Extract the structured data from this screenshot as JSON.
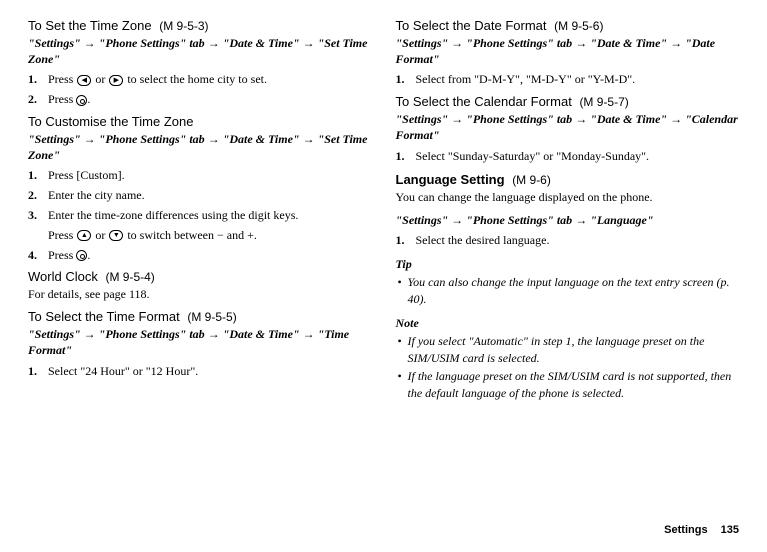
{
  "left": {
    "setTimeZone": {
      "title": "To Set the Time Zone",
      "code": "(M 9-5-3)",
      "path": [
        "\"Settings\"",
        "\"Phone Settings\" tab",
        "\"Date & Time\"",
        "\"Set Time Zone\""
      ],
      "steps": [
        "Press ◀ or ▶ to select the home city to set.",
        "Press ⦿."
      ]
    },
    "customiseTimeZone": {
      "title": "To Customise the Time Zone",
      "path": [
        "\"Settings\"",
        "\"Phone Settings\" tab",
        "\"Date & Time\"",
        "\"Set Time Zone\""
      ],
      "steps": [
        "Press [Custom].",
        "Enter the city name.",
        "Enter the time-zone differences using the digit keys.",
        "Press ⦿."
      ],
      "sub3": "Press ▲ or ▼ to switch between − and +."
    },
    "worldClock": {
      "title": "World Clock",
      "code": "(M 9-5-4)",
      "text": "For details, see page 118."
    },
    "timeFormat": {
      "title": "To Select the Time Format",
      "code": "(M 9-5-5)",
      "path": [
        "\"Settings\"",
        "\"Phone Settings\" tab",
        "\"Date & Time\"",
        "\"Time Format\""
      ],
      "steps": [
        "Select \"24 Hour\" or \"12 Hour\"."
      ]
    }
  },
  "right": {
    "dateFormat": {
      "title": "To Select the Date Format",
      "code": "(M 9-5-6)",
      "path": [
        "\"Settings\"",
        "\"Phone Settings\" tab",
        "\"Date & Time\"",
        "\"Date Format\""
      ],
      "steps": [
        "Select from \"D-M-Y\", \"M-D-Y\" or \"Y-M-D\"."
      ]
    },
    "calendarFormat": {
      "title": "To Select the Calendar Format",
      "code": "(M 9-5-7)",
      "path": [
        "\"Settings\"",
        "\"Phone Settings\" tab",
        "\"Date & Time\"",
        "\"Calendar Format\""
      ],
      "steps": [
        "Select \"Sunday-Saturday\" or \"Monday-Sunday\"."
      ]
    },
    "languageSetting": {
      "title": "Language Setting",
      "code": "(M 9-6)",
      "intro": "You can change the language displayed on the phone.",
      "path": [
        "\"Settings\"",
        "\"Phone Settings\" tab",
        "\"Language\""
      ],
      "steps": [
        "Select the desired language."
      ]
    },
    "tip": {
      "heading": "Tip",
      "items": [
        "You can also change the input language on the text entry screen (p. 40)."
      ]
    },
    "note": {
      "heading": "Note",
      "items": [
        "If you select \"Automatic\" in step 1, the language preset on the SIM/USIM card is selected.",
        "If the language preset on the SIM/USIM card is not supported, then the default language of the phone is selected."
      ]
    }
  },
  "footer": {
    "section": "Settings",
    "page": "135"
  }
}
